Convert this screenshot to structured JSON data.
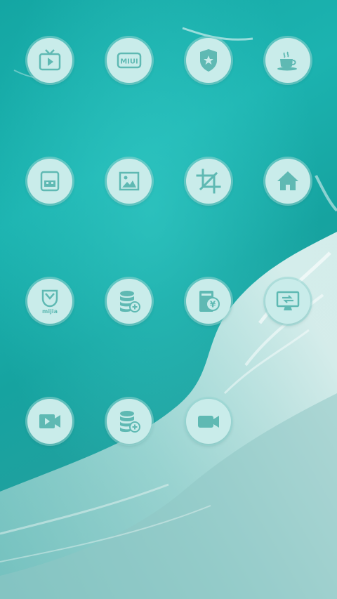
{
  "colors": {
    "icon_bg": "#c9ecea",
    "icon_glyph": "#5fb9b3",
    "sea_dark": "#0e8f8f",
    "sea_light": "#2ec7c3",
    "foam": "#e8f4f2"
  },
  "apps": [
    {
      "id": "tv",
      "icon": "tv-play-icon",
      "text": ""
    },
    {
      "id": "miui",
      "icon": "miui-icon",
      "text": "MIUI"
    },
    {
      "id": "badge",
      "icon": "police-badge-icon",
      "text": ""
    },
    {
      "id": "coffee",
      "icon": "coffee-cup-icon",
      "text": ""
    },
    {
      "id": "storage",
      "icon": "usb-drive-icon",
      "text": ""
    },
    {
      "id": "gallery",
      "icon": "gallery-picture-icon",
      "text": ""
    },
    {
      "id": "crop",
      "icon": "crop-icon",
      "text": ""
    },
    {
      "id": "home",
      "icon": "home-icon",
      "text": ""
    },
    {
      "id": "mijia",
      "icon": "mijia-icon",
      "text": "mijia"
    },
    {
      "id": "database1",
      "icon": "database-add-icon",
      "text": ""
    },
    {
      "id": "wallet",
      "icon": "yen-wallet-icon",
      "text": "¥"
    },
    {
      "id": "monitor",
      "icon": "monitor-transfer-icon",
      "text": ""
    },
    {
      "id": "video",
      "icon": "video-play-icon",
      "text": ""
    },
    {
      "id": "database2",
      "icon": "database-add-icon",
      "text": ""
    },
    {
      "id": "camera",
      "icon": "video-camera-icon",
      "text": ""
    }
  ]
}
